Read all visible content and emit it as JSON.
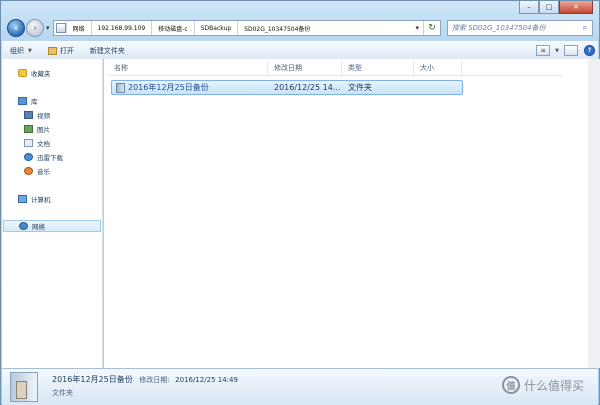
{
  "titlebar": {
    "minimize": "–",
    "maximize": "□",
    "close": "✕"
  },
  "address": {
    "breadcrumbs": [
      "网络",
      "192.168.99.109",
      "移动磁盘-c",
      "SDBackup",
      "SD02G_10347504备份"
    ],
    "dropdown": "▾",
    "refresh": "↻",
    "search_placeholder": "搜索 SD02G_10347504备份"
  },
  "toolbar": {
    "organize": "组织",
    "open": "打开",
    "new_folder": "新建文件夹"
  },
  "nav": {
    "favorites": "收藏夹",
    "library": "库",
    "video": "视频",
    "pictures": "图片",
    "documents": "文档",
    "thunder": "迅雷下载",
    "music": "音乐",
    "computer": "计算机",
    "network": "网络"
  },
  "columns": {
    "name": "名称",
    "modified": "修改日期",
    "type": "类型",
    "size": "大小"
  },
  "rows": [
    {
      "name": "2016年12月25日备份",
      "modified": "2016/12/25 14...",
      "type": "文件夹",
      "size": ""
    }
  ],
  "details": {
    "name": "2016年12月25日备份",
    "modified_label": "修改日期:",
    "modified": "2016/12/25 14:49",
    "type": "文件夹"
  },
  "watermark": {
    "symbol": "值",
    "text": "什么值得买"
  }
}
